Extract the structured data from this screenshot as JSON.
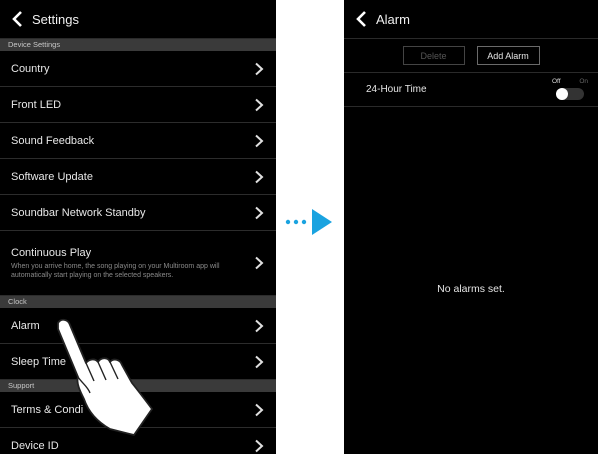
{
  "settings": {
    "title": "Settings",
    "sections": {
      "device": "Device Settings",
      "clock": "Clock",
      "support": "Support"
    },
    "items": {
      "country": "Country",
      "front_led": "Front LED",
      "sound_feedback": "Sound Feedback",
      "software_update": "Software Update",
      "network_standby": "Soundbar Network Standby",
      "continuous_play": "Continuous Play",
      "continuous_play_desc": "When you arrive home, the song playing on your Multiroom app will automatically start playing on the selected speakers.",
      "alarm": "Alarm",
      "sleep_timer": "Sleep Time",
      "terms": "Terms & Condi",
      "device_id": "Device ID"
    }
  },
  "alarm": {
    "title": "Alarm",
    "delete_label": "Delete",
    "add_label": "Add Alarm",
    "time_format_label": "24-Hour Time",
    "toggle_off": "Off",
    "toggle_on": "On",
    "toggle_state": "off",
    "empty_message": "No alarms set."
  },
  "colors": {
    "screen_background": "#000000",
    "section_background": "#3a3a3a",
    "arrow_accent": "#1aa3e0"
  },
  "icons": [
    "chevron-left-icon",
    "chevron-right-icon",
    "hand-pointer-icon",
    "arrow-right-icon"
  ]
}
